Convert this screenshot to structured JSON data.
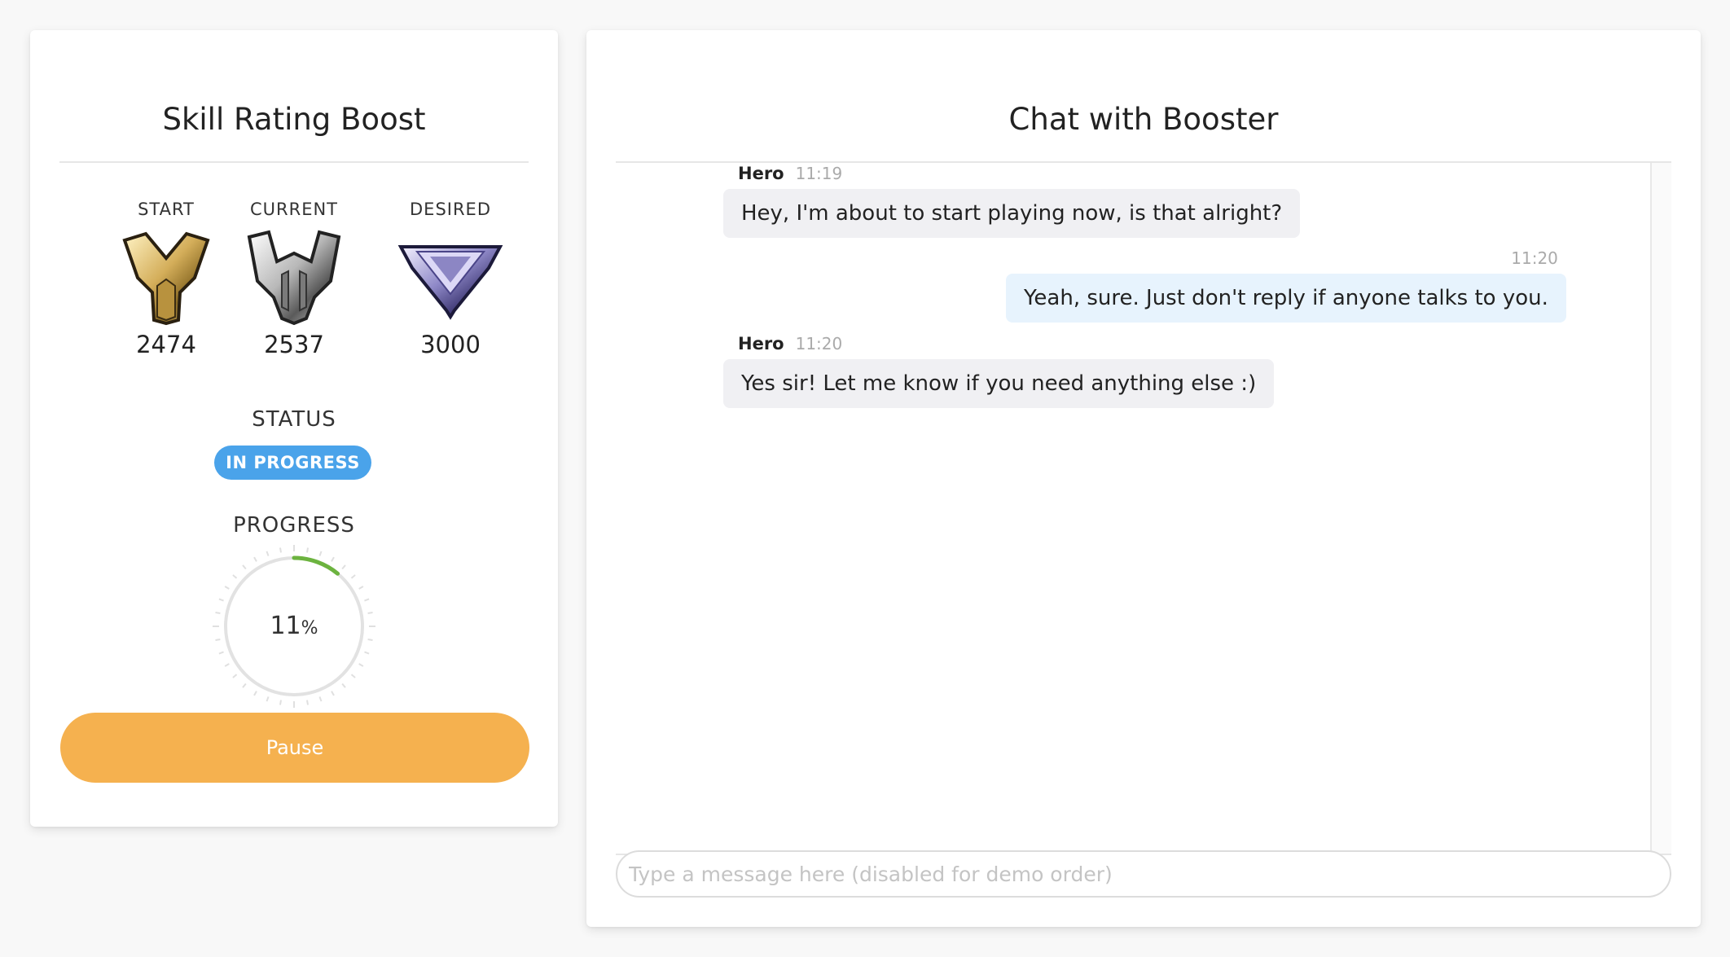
{
  "boost_card": {
    "title": "Skill Rating Boost",
    "ranks": [
      {
        "label": "START",
        "value": "2474",
        "icon": "gold-rank-icon"
      },
      {
        "label": "CURRENT",
        "value": "2537",
        "icon": "platinum-rank-icon"
      },
      {
        "label": "DESIRED",
        "value": "3000",
        "icon": "master-rank-icon"
      }
    ],
    "status_label": "STATUS",
    "status_badge": "IN PROGRESS",
    "progress_label": "PROGRESS",
    "progress_value": "11",
    "progress_unit": "%",
    "progress_fraction": 0.11,
    "pause_label": "Pause"
  },
  "chat_card": {
    "title": "Chat with Booster",
    "messages": [
      {
        "author": "Hero",
        "time": "11:19",
        "text": "Hey, I'm about to start playing now, is that alright?"
      },
      {
        "author": "",
        "time": "11:20",
        "text": "Yeah, sure. Just don't reply if anyone talks to you."
      },
      {
        "author": "Hero",
        "time": "11:20",
        "text": "Yes sir! Let me know if you need anything else :)"
      }
    ],
    "input_placeholder": "Type a message here (disabled for demo order)"
  },
  "colors": {
    "status_badge": "#4aa3ea",
    "pause_button": "#f5b14f",
    "progress_arc": "#6cb33f",
    "my_bubble": "#e7f3fd",
    "their_bubble": "#f0f0f3"
  }
}
